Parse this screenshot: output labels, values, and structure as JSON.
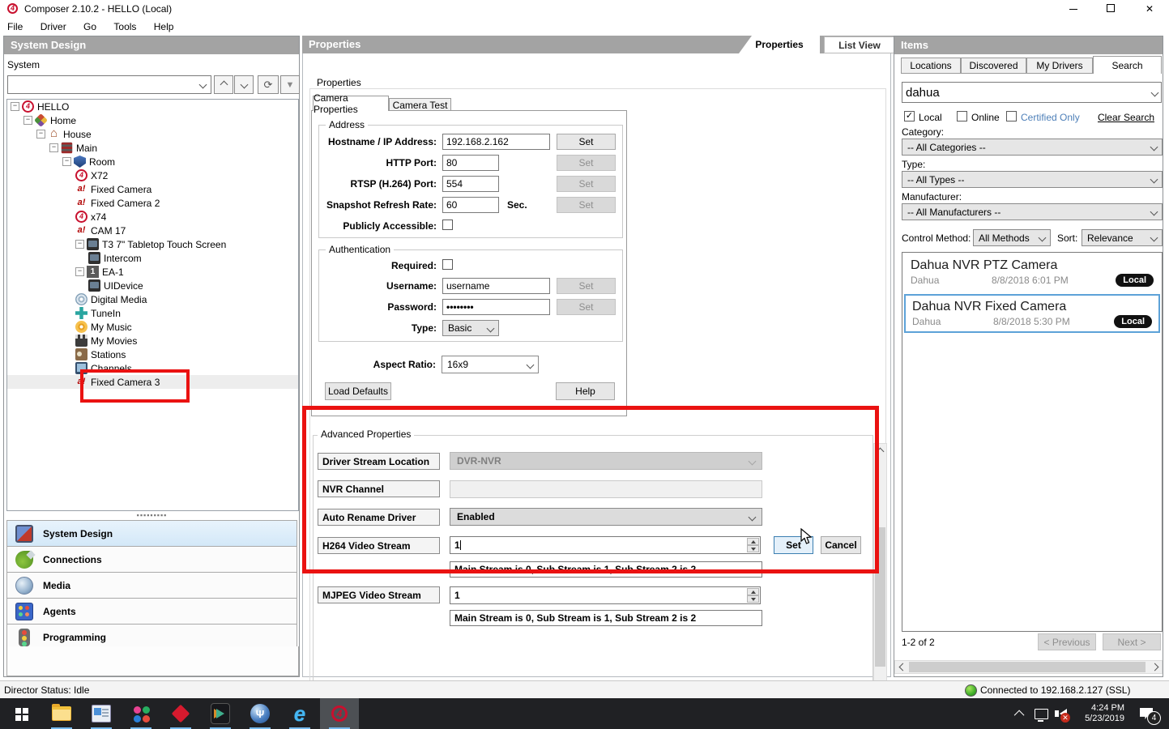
{
  "window": {
    "title": "Composer 2.10.2 - HELLO (Local)"
  },
  "menu": {
    "items": [
      "File",
      "Driver",
      "Go",
      "Tools",
      "Help"
    ]
  },
  "left_panel": {
    "header": "System Design",
    "system_label": "System",
    "tree": [
      {
        "label": "HELLO",
        "icon": "c4",
        "depth": 0,
        "expandable": true
      },
      {
        "label": "Home",
        "icon": "home",
        "depth": 1,
        "expandable": true
      },
      {
        "label": "House",
        "icon": "house",
        "depth": 2,
        "expandable": true
      },
      {
        "label": "Main",
        "icon": "floor",
        "depth": 3,
        "expandable": true
      },
      {
        "label": "Room",
        "icon": "room",
        "depth": 4,
        "expandable": true
      },
      {
        "label": "X72",
        "icon": "c4",
        "depth": 5
      },
      {
        "label": "Fixed Camera",
        "icon": "ai",
        "depth": 5
      },
      {
        "label": "Fixed Camera 2",
        "icon": "ai",
        "depth": 5
      },
      {
        "label": "x74",
        "icon": "c4",
        "depth": 5
      },
      {
        "label": "CAM 17",
        "icon": "ai",
        "depth": 5
      },
      {
        "label": "T3 7\" Tabletop Touch Screen",
        "icon": "touchscreen",
        "depth": 5,
        "expandable": true
      },
      {
        "label": "Intercom",
        "icon": "touchscreen",
        "depth": 6
      },
      {
        "label": "EA-1",
        "icon": "ea1",
        "depth": 5,
        "expandable": true
      },
      {
        "label": "UIDevice",
        "icon": "touchscreen",
        "depth": 6
      },
      {
        "label": "Digital Media",
        "icon": "disc",
        "depth": 5
      },
      {
        "label": "TuneIn",
        "icon": "tunein",
        "depth": 5
      },
      {
        "label": "My Music",
        "icon": "music",
        "depth": 5
      },
      {
        "label": "My Movies",
        "icon": "movies",
        "depth": 5
      },
      {
        "label": "Stations",
        "icon": "stations",
        "depth": 5
      },
      {
        "label": "Channels",
        "icon": "channels",
        "depth": 5
      },
      {
        "label": "Fixed Camera 3",
        "icon": "ai",
        "depth": 5,
        "selected": true
      }
    ],
    "nav": [
      {
        "label": "System Design",
        "selected": true
      },
      {
        "label": "Connections"
      },
      {
        "label": "Media"
      },
      {
        "label": "Agents"
      },
      {
        "label": "Programming"
      }
    ]
  },
  "properties_panel": {
    "header": "Properties",
    "view_tabs": {
      "properties": "Properties",
      "list_view": "List View"
    },
    "section_label": "Properties",
    "camera_tabs": {
      "active": "Camera Properties",
      "inactive": "Camera Test"
    },
    "address": {
      "legend": "Address",
      "rows": [
        {
          "label": "Hostname / IP Address:",
          "value": "192.168.2.162",
          "button": "Set"
        },
        {
          "label": "HTTP Port:",
          "value": "80",
          "button": "Set"
        },
        {
          "label": "RTSP (H.264) Port:",
          "value": "554",
          "button": "Set"
        },
        {
          "label": "Snapshot Refresh Rate:",
          "value": "60",
          "suffix": "Sec.",
          "button": "Set"
        }
      ],
      "publicly_accessible_label": "Publicly Accessible:"
    },
    "authentication": {
      "legend": "Authentication",
      "required_label": "Required:",
      "username_label": "Username:",
      "username_value": "username",
      "password_label": "Password:",
      "password_value": "••••••••",
      "type_label": "Type:",
      "type_value": "Basic",
      "set_label": "Set"
    },
    "aspect_ratio_label": "Aspect Ratio:",
    "aspect_ratio_value": "16x9",
    "load_defaults_label": "Load Defaults",
    "help_label": "Help",
    "advanced": {
      "legend": "Advanced Properties",
      "driver_stream_location": {
        "label": "Driver Stream Location",
        "value": "DVR-NVR"
      },
      "nvr_channel": {
        "label": "NVR Channel",
        "value": ""
      },
      "auto_rename_driver": {
        "label": "Auto Rename Driver",
        "value": "Enabled"
      },
      "h264_video_stream": {
        "label": "H264 Video Stream",
        "value": "1",
        "hint": "Main Stream is 0, Sub Stream is 1, Sub Stream 2 is 2",
        "set_label": "Set",
        "cancel_label": "Cancel"
      },
      "mjpeg_video_stream": {
        "label": "MJPEG Video Stream",
        "value": "1",
        "hint": "Main Stream is 0, Sub Stream is 1, Sub Stream 2 is 2"
      }
    }
  },
  "items_panel": {
    "header": "Items",
    "tabs": [
      {
        "label": "Locations"
      },
      {
        "label": "Discovered"
      },
      {
        "label": "My Drivers"
      },
      {
        "label": "Search",
        "active": true
      }
    ],
    "search_value": "dahua",
    "checkboxes": [
      {
        "label": "Local",
        "checked": true
      },
      {
        "label": "Online",
        "checked": false
      },
      {
        "label": "Certified Only",
        "checked": false
      }
    ],
    "clear_search_label": "Clear Search",
    "category_label": "Category:",
    "category_value": "-- All Categories --",
    "type_label": "Type:",
    "type_value": "-- All Types --",
    "manufacturer_label": "Manufacturer:",
    "manufacturer_value": "-- All Manufacturers --",
    "control_method_label": "Control Method:",
    "control_method_value": "All Methods",
    "sort_label": "Sort:",
    "sort_value": "Relevance",
    "results": [
      {
        "title": "Dahua NVR PTZ Camera",
        "maker": "Dahua",
        "date": "8/8/2018 6:01 PM",
        "badge": "Local",
        "selected": false
      },
      {
        "title": "Dahua NVR Fixed Camera",
        "maker": "Dahua",
        "date": "8/8/2018 5:30 PM",
        "badge": "Local",
        "selected": true
      }
    ],
    "pager": {
      "count": "1-2 of 2",
      "prev": "< Previous",
      "next": "Next >"
    }
  },
  "status_bar": {
    "left": "Director Status: Idle",
    "connection": "Connected to 192.168.2.127 (SSL)"
  },
  "taskbar": {
    "tray": {
      "time": "4:24 PM",
      "date": "5/23/2019",
      "notification_count": "4"
    }
  }
}
